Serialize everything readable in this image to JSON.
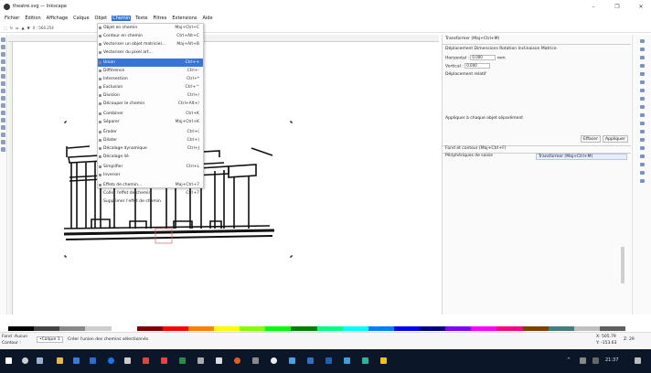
{
  "window": {
    "title": "theatre.svg — Inkscape",
    "controls": [
      "–",
      "❐",
      "✕"
    ]
  },
  "menubar": [
    "Fichier",
    "Édition",
    "Affichage",
    "Calque",
    "Objet",
    "Chemin",
    "Texte",
    "Filtres",
    "Extensions",
    "Aide"
  ],
  "toolbar": {
    "coords": "X : 564.254"
  },
  "chemin_menu": {
    "items": [
      {
        "label": "Objet en chemin",
        "shortcut": "Maj+Ctrl+C"
      },
      {
        "label": "Contour en chemin",
        "shortcut": "Ctrl+Alt+C"
      },
      {
        "label": "Vectoriser un objet matriciel...",
        "shortcut": "Maj+Alt+B"
      },
      {
        "label": "Vectoriser du pixel art...",
        "shortcut": ""
      },
      {
        "label": "Union",
        "shortcut": "Ctrl++"
      },
      {
        "label": "Différence",
        "shortcut": "Ctrl+-"
      },
      {
        "label": "Intersection",
        "shortcut": "Ctrl+*"
      },
      {
        "label": "Exclusion",
        "shortcut": "Ctrl+^"
      },
      {
        "label": "Division",
        "shortcut": "Ctrl+/"
      },
      {
        "label": "Découper le chemin",
        "shortcut": "Ctrl+Alt+/"
      },
      {
        "label": "Combiner",
        "shortcut": "Ctrl+K"
      },
      {
        "label": "Séparer",
        "shortcut": "Maj+Ctrl+K"
      },
      {
        "label": "Éroder",
        "shortcut": "Ctrl+("
      },
      {
        "label": "Dilater",
        "shortcut": "Ctrl+)"
      },
      {
        "label": "Décalage dynamique",
        "shortcut": "Ctrl+J"
      },
      {
        "label": "Décalage lié",
        "shortcut": ""
      },
      {
        "label": "Simplifier",
        "shortcut": "Ctrl+L"
      },
      {
        "label": "Inverser",
        "shortcut": ""
      },
      {
        "label": "Effets de chemin...",
        "shortcut": "Maj+Ctrl+7"
      },
      {
        "label": "Coller l'effet de chemin",
        "shortcut": "Ctrl+7"
      },
      {
        "label": "Supprimer l'effet de chemin",
        "shortcut": ""
      }
    ]
  },
  "transform_panel": {
    "title": "Transformer (Maj+Ctrl+M)",
    "tabs": "Déplacement Dimensions Rotation Inclinaison Matrice",
    "horizontal_label": "Horizontal :",
    "horizontal_value": "0.000",
    "vertical_label": "Vertical :",
    "vertical_value": "0.000",
    "unit": "mm",
    "relative": "Déplacement relatif",
    "apply_each": "Appliquer à chaque objet séparément",
    "clear_button": "Effacer",
    "apply_button": "Appliquer",
    "fill_stroke": "Fond et contour (Maj+Ctrl+F)",
    "input_devices": "Périphériques de saisie",
    "transform_tab": "Transformer (Maj+Ctrl+M)"
  },
  "statusbar": {
    "fill_label": "Fond :",
    "fill_value": "Aucun",
    "stroke_label": "Contour :",
    "layer": "•Calque 1",
    "message": "Créer l'union des chemins sélectionnés",
    "x_readout": "X: 505.79",
    "y_readout": "Y: -153.63",
    "zoom": "Z: 29"
  },
  "taskbar": {
    "time": "21:37"
  },
  "colors": {
    "highlight": "#3874d8",
    "taskbar": "#0b1628"
  }
}
